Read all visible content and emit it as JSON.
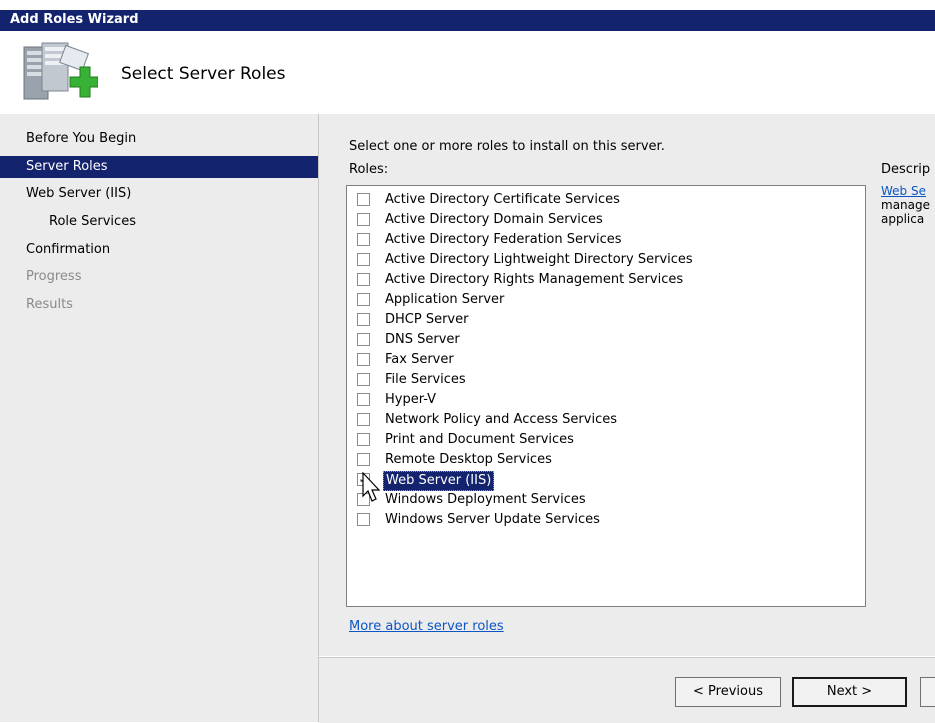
{
  "window": {
    "title": "Add Roles Wizard"
  },
  "header": {
    "heading": "Select Server Roles",
    "icon": "server-roles-add-icon"
  },
  "nav": {
    "items": [
      {
        "label": "Before You Begin",
        "state": "normal",
        "indent": 0
      },
      {
        "label": "Server Roles",
        "state": "active",
        "indent": 0
      },
      {
        "label": "Web Server (IIS)",
        "state": "normal",
        "indent": 0
      },
      {
        "label": "Role Services",
        "state": "normal",
        "indent": 1
      },
      {
        "label": "Confirmation",
        "state": "normal",
        "indent": 0
      },
      {
        "label": "Progress",
        "state": "disabled",
        "indent": 0
      },
      {
        "label": "Results",
        "state": "disabled",
        "indent": 0
      }
    ]
  },
  "main": {
    "instruction": "Select one or more roles to install on this server.",
    "roles_label": "Roles:",
    "roles": [
      {
        "label": "Active Directory Certificate Services",
        "checked": false
      },
      {
        "label": "Active Directory Domain Services",
        "checked": false
      },
      {
        "label": "Active Directory Federation Services",
        "checked": false
      },
      {
        "label": "Active Directory Lightweight Directory Services",
        "checked": false
      },
      {
        "label": "Active Directory Rights Management Services",
        "checked": false
      },
      {
        "label": "Application Server",
        "checked": false
      },
      {
        "label": "DHCP Server",
        "checked": false
      },
      {
        "label": "DNS Server",
        "checked": false
      },
      {
        "label": "Fax Server",
        "checked": false
      },
      {
        "label": "File Services",
        "checked": false
      },
      {
        "label": "Hyper-V",
        "checked": false
      },
      {
        "label": "Network Policy and Access Services",
        "checked": false
      },
      {
        "label": "Print and Document Services",
        "checked": false
      },
      {
        "label": "Remote Desktop Services",
        "checked": false
      },
      {
        "label": "Web Server (IIS)",
        "checked": true,
        "selected": true
      },
      {
        "label": "Windows Deployment Services",
        "checked": false
      },
      {
        "label": "Windows Server Update Services",
        "checked": false
      }
    ],
    "more_link": "More about server roles",
    "description": {
      "label": "Descrip",
      "link": "Web Se",
      "lines": [
        "manage",
        "applica"
      ]
    }
  },
  "footer": {
    "previous_label": "< Previous",
    "next_label": "Next >"
  },
  "colors": {
    "title_bar": "#14236e",
    "selection": "#14236e",
    "pane_bg": "#ececec",
    "link": "#0b56c4"
  }
}
